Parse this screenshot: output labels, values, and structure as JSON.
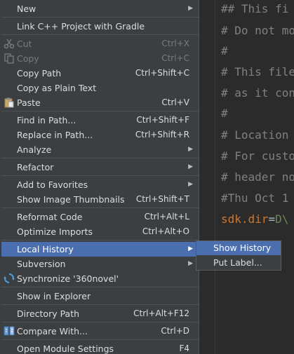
{
  "editor": {
    "lines": [
      "## This fi",
      "# Do not mo",
      "#",
      "# This file",
      "# as it con",
      "#",
      "# Location",
      "# For custo",
      "# header no",
      "#Thu Oct 1"
    ],
    "sdk_key": "sdk.dir",
    "sdk_eq": "=",
    "sdk_val": "D\\"
  },
  "menu": {
    "items": [
      {
        "label": "New",
        "shortcut": "",
        "submenu": true
      },
      {
        "label": "Link C++ Project with Gradle",
        "shortcut": ""
      },
      {
        "label": "Cut",
        "shortcut": "Ctrl+X",
        "disabled": true,
        "icon": "scissors-icon"
      },
      {
        "label": "Copy",
        "shortcut": "Ctrl+C",
        "disabled": true,
        "icon": "copy-icon"
      },
      {
        "label": "Copy Path",
        "shortcut": "Ctrl+Shift+C"
      },
      {
        "label": "Copy as Plain Text",
        "shortcut": ""
      },
      {
        "label": "Paste",
        "shortcut": "Ctrl+V",
        "icon": "paste-icon"
      },
      {
        "label": "Find in Path...",
        "shortcut": "Ctrl+Shift+F"
      },
      {
        "label": "Replace in Path...",
        "shortcut": "Ctrl+Shift+R"
      },
      {
        "label": "Analyze",
        "shortcut": "",
        "submenu": true
      },
      {
        "label": "Refactor",
        "shortcut": "",
        "submenu": true
      },
      {
        "label": "Add to Favorites",
        "shortcut": "",
        "submenu": true
      },
      {
        "label": "Show Image Thumbnails",
        "shortcut": "Ctrl+Shift+T"
      },
      {
        "label": "Reformat Code",
        "shortcut": "Ctrl+Alt+L"
      },
      {
        "label": "Optimize Imports",
        "shortcut": "Ctrl+Alt+O"
      },
      {
        "label": "Local History",
        "shortcut": "",
        "submenu": true,
        "selected": true
      },
      {
        "label": "Subversion",
        "shortcut": "",
        "submenu": true
      },
      {
        "label": "Synchronize '360novel'",
        "shortcut": "",
        "icon": "sync-icon"
      },
      {
        "label": "Show in Explorer",
        "shortcut": ""
      },
      {
        "label": "Directory Path",
        "shortcut": "Ctrl+Alt+F12"
      },
      {
        "label": "Compare With...",
        "shortcut": "Ctrl+D",
        "icon": "compare-icon"
      },
      {
        "label": "Open Module Settings",
        "shortcut": "F4"
      }
    ]
  },
  "submenu": {
    "items": [
      {
        "label": "Show History",
        "selected": true
      },
      {
        "label": "Put Label..."
      }
    ]
  },
  "colors": {
    "menu_bg": "#3c3f41",
    "selection": "#4b6eaf",
    "editor_bg": "#2b2b2b",
    "comment": "#808080",
    "key": "#cc7832",
    "value": "#6a8759"
  }
}
